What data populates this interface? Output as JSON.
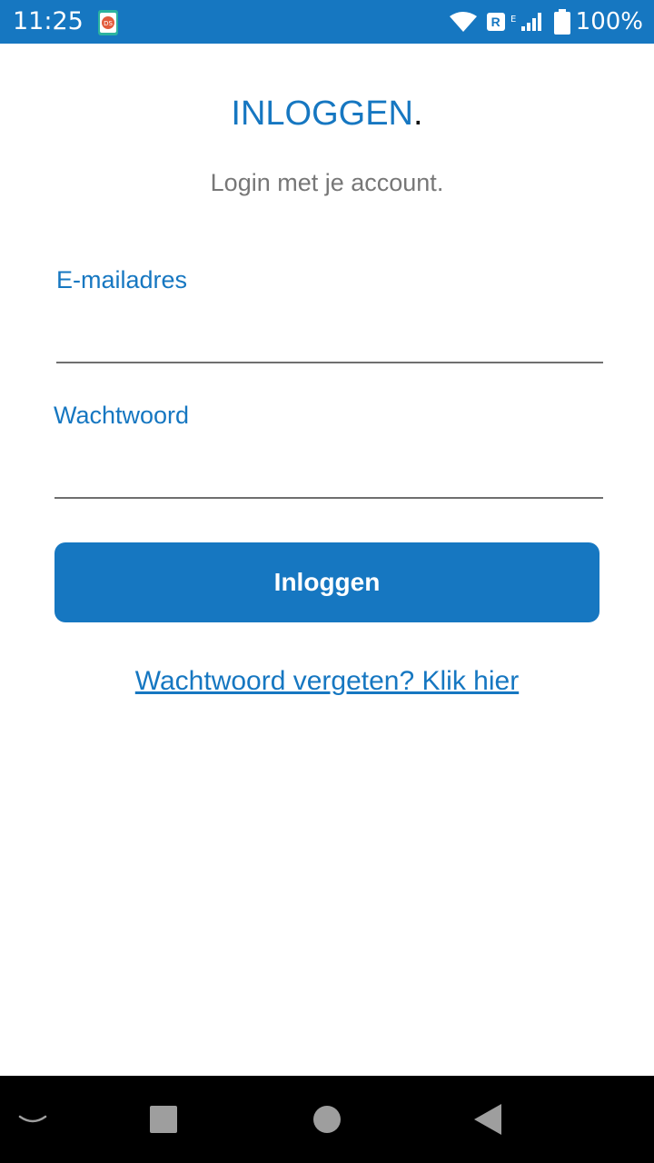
{
  "status_bar": {
    "time": "11:25",
    "notification_icon": "ds-app-icon",
    "wifi_icon": "wifi-icon",
    "roaming_label": "R",
    "network_type": "E",
    "signal_icon": "signal-icon",
    "battery_icon": "battery-icon",
    "battery_level": "100%",
    "background_color": "#1677c1"
  },
  "login": {
    "title": "INLOGGEN",
    "title_suffix": ".",
    "subtitle": "Login met je account.",
    "email": {
      "label": "E-mailadres",
      "value": "",
      "placeholder": ""
    },
    "password": {
      "label": "Wachtwoord",
      "value": "",
      "placeholder": ""
    },
    "submit_label": "Inloggen",
    "forgot_link": "Wachtwoord vergeten? Klik hier"
  },
  "nav_bar": {
    "hide_keyboard_icon": "chevron-down-icon",
    "recents_icon": "square-icon",
    "home_icon": "circle-icon",
    "back_icon": "triangle-back-icon"
  },
  "colors": {
    "accent": "#1677c1",
    "subtitle_text": "#777777",
    "underline": "#6f6f6f",
    "nav_background": "#000000",
    "nav_icons": "#9e9e9e"
  }
}
